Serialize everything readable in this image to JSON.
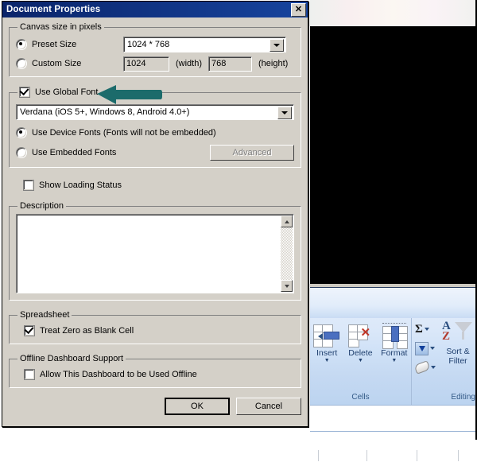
{
  "dialog": {
    "title": "Document Properties",
    "close_icon": "close-x-icon",
    "canvas_group": {
      "legend": "Canvas size in pixels",
      "preset_label": "Preset Size",
      "preset_value": "1024 * 768",
      "preset_selected": true,
      "custom_label": "Custom Size",
      "custom_selected": false,
      "width_value": "1024",
      "width_suffix": "(width)",
      "height_value": "768",
      "height_suffix": "(height)"
    },
    "font_group": {
      "use_global_font_label": "Use Global Font",
      "use_global_font_checked": true,
      "font_value": "Verdana (iOS 5+, Windows 8, Android 4.0+)",
      "device_fonts_label": "Use Device Fonts (Fonts will not be embedded)",
      "device_fonts_selected": true,
      "embedded_fonts_label": "Use Embedded Fonts",
      "embedded_fonts_selected": false,
      "advanced_label": "Advanced",
      "advanced_disabled": true
    },
    "show_loading_status_label": "Show Loading Status",
    "show_loading_status_checked": false,
    "description_group": {
      "legend": "Description",
      "value": ""
    },
    "spreadsheet_group": {
      "legend": "Spreadsheet",
      "treat_zero_label": "Treat Zero as Blank Cell",
      "treat_zero_checked": true
    },
    "offline_group": {
      "legend": "Offline Dashboard Support",
      "allow_offline_label": "Allow This Dashboard to be Used Offline",
      "allow_offline_checked": false
    },
    "footer": {
      "ok_label": "OK",
      "cancel_label": "Cancel"
    }
  },
  "annotation": {
    "arrow_color": "#1c6b6b",
    "points_to": "Use Global Font"
  },
  "excel": {
    "ribbon": {
      "groups": [
        {
          "name": "Cells",
          "label": "Cells",
          "buttons": [
            {
              "label": "Insert",
              "icon": "insert-cells-icon",
              "caret": "▼"
            },
            {
              "label": "Delete",
              "icon": "delete-cells-icon",
              "caret": "▼"
            },
            {
              "label": "Format",
              "icon": "format-cells-icon",
              "caret": "▼"
            }
          ]
        },
        {
          "name": "Editing",
          "label": "Editing",
          "buttons": [
            {
              "label": "",
              "icon": "autosum-sigma-icon",
              "caret": "▼"
            },
            {
              "label": "",
              "icon": "fill-down-icon",
              "caret": "▼"
            },
            {
              "label": "",
              "icon": "clear-eraser-icon",
              "caret": "▼"
            }
          ],
          "sort_filter_label": "Sort &\nFilter",
          "sort_filter_line1": "Sort &",
          "sort_filter_line2": "Filter",
          "sort_filter_icon": "sort-az-filter-icon"
        }
      ]
    },
    "colors": {
      "ribbon_bg": "#cfe1f7",
      "label_text": "#335a87",
      "black_area": "#000000"
    }
  }
}
